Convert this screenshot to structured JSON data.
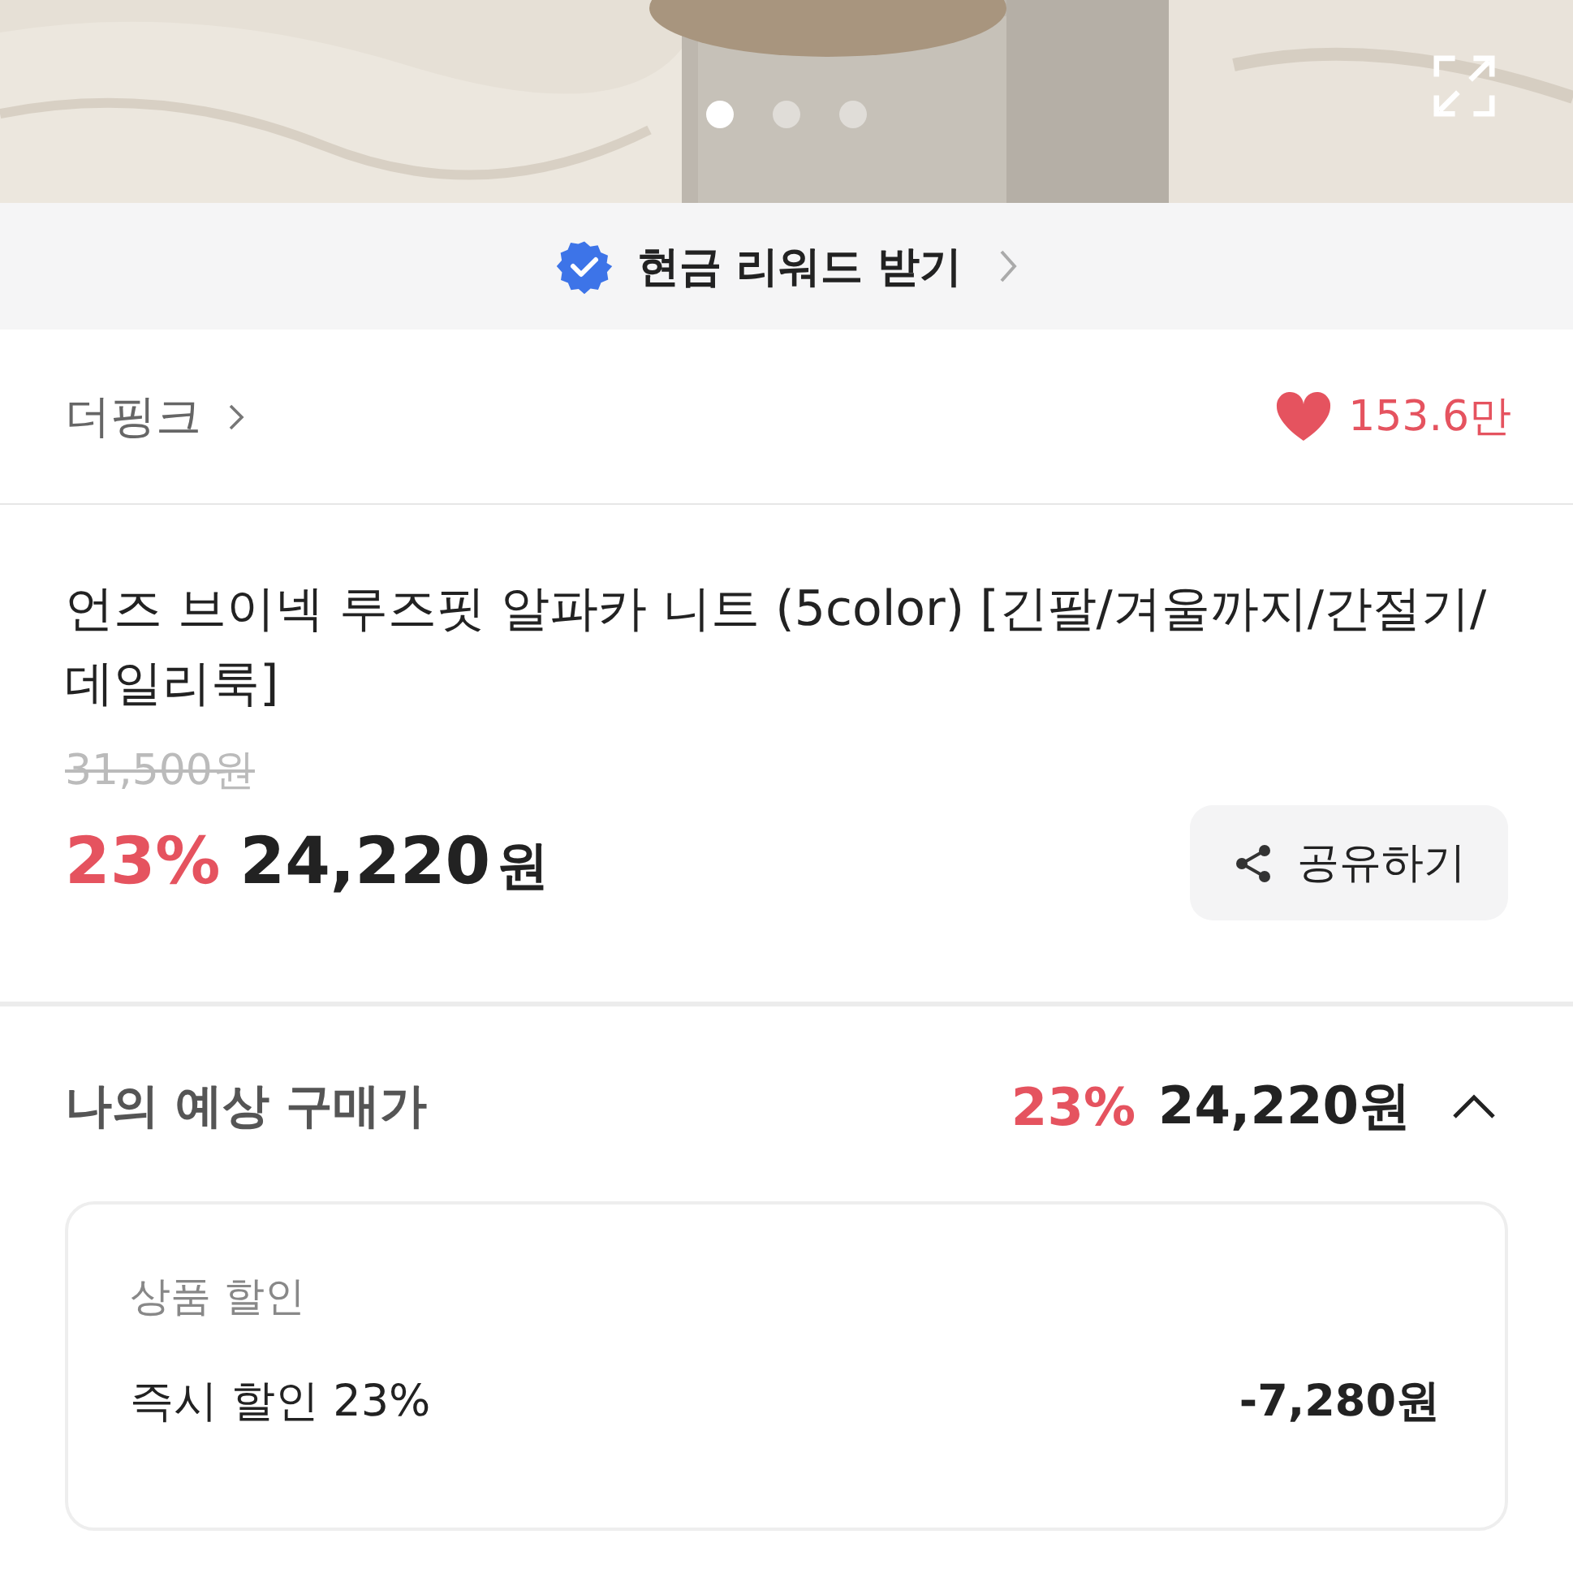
{
  "photo": {
    "dots": [
      {
        "selected": true
      },
      {
        "selected": false
      },
      {
        "selected": false
      }
    ]
  },
  "reward": {
    "label": "현금 리워드 받기"
  },
  "brand": {
    "name": "더핑크",
    "likes": "153.6만"
  },
  "product": {
    "title": "언즈 브이넥 루즈핏 알파카 니트 (5color) [긴팔/겨울까지/간절기/데일리룩]",
    "original_price": "31,500원",
    "discount": "23%",
    "price": "24,220",
    "currency": "원",
    "share": "공유하기"
  },
  "estimate": {
    "label": "나의 예상 구매가",
    "discount": "23%",
    "price": "24,220원",
    "expanded": true
  },
  "breakdown": {
    "section_title": "상품 할인",
    "rows": [
      {
        "label": "즉시 할인 23%",
        "amount": "-7,280원"
      }
    ]
  }
}
